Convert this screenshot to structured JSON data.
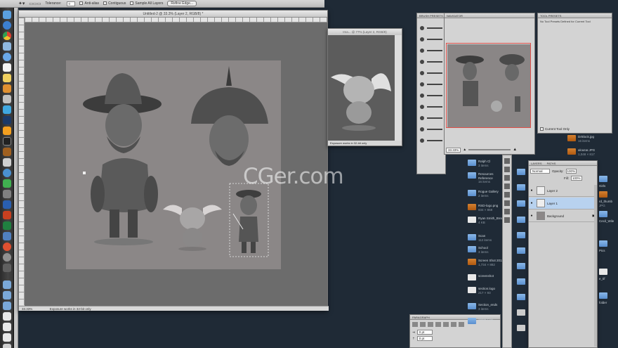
{
  "options_bar": {
    "tolerance_label": "Tolerance:",
    "tolerance_value": "0",
    "antialias_label": "Anti-alias",
    "contiguous_label": "Contiguous",
    "sample_label": "Sample All Layers",
    "refine_label": "Refine Edge..."
  },
  "document": {
    "title": "Untitled-2 @ 33.3% (Layer 2, RGB/8) *",
    "zoom": "33.33%",
    "status": "Exposure works in 32-bit only"
  },
  "document2": {
    "title": "Ima... @ 77% (Layer 2, RGB/8)",
    "status": "Exposure works in 32-bit only"
  },
  "panels": {
    "brush_presets_tab": "BRUSH PRESETS",
    "navigator_tab": "NAVIGATOR",
    "navigator_zoom": "33.33%",
    "tool_presets_tab": "TOOL PRESETS",
    "tool_presets_item": "No Tool Presets Defined for Current Tool",
    "current_tool_only": "Current Tool Only",
    "layers_tab": "LAYERS",
    "paths_tab": "PATHS",
    "blend_mode": "Normal",
    "opacity_label": "Opacity:",
    "opacity_value": "100%",
    "fill_label": "Fill:",
    "fill_value": "100%",
    "layers": [
      {
        "name": "Layer 2",
        "selected": false
      },
      {
        "name": "Layer 1",
        "selected": true
      },
      {
        "name": "Background",
        "selected": false
      }
    ],
    "paragraph_tab": "PARAGRAPH",
    "para_field_1": "0 pt",
    "para_field_2": "0 pt"
  },
  "finder_files": [
    {
      "name": "Ralph Cl",
      "sub": "3 items",
      "kind": "folder"
    },
    {
      "name": "Resources",
      "sub": "",
      "kind": "folder"
    },
    {
      "name": "Reference",
      "sub": "16 items",
      "kind": "folder"
    },
    {
      "name": "Rogue Gallery",
      "sub": "2 items",
      "kind": "folder"
    },
    {
      "name": "RSD-logo.png",
      "sub": "934 × 858",
      "kind": "image"
    },
    {
      "name": "Ryan Smith_Bread",
      "sub": "4 KB",
      "kind": "doc"
    },
    {
      "name": "Scan",
      "sub": "112 items",
      "kind": "folder"
    },
    {
      "name": "School",
      "sub": "3 items",
      "kind": "folder"
    },
    {
      "name": "Screen Shot 2012-03-...",
      "sub": "1,734 × 882",
      "kind": "image"
    },
    {
      "name": "screenshot",
      "sub": "",
      "kind": "doc"
    },
    {
      "name": "section.logo",
      "sub": "217 × 93",
      "kind": "doc"
    },
    {
      "name": "Section_ends",
      "sub": "3 items",
      "kind": "folder"
    },
    {
      "name": "Sister Cou...",
      "sub": "",
      "kind": "folder"
    }
  ],
  "finder_right": [
    {
      "name": "DrBlock.jpg",
      "sub": "16 items"
    },
    {
      "name": "alcazar.JPG",
      "sub": "1,048 × 817"
    },
    {
      "name": "Girls",
      "sub": ""
    },
    {
      "name": "rd_thumb",
      "sub": "JPG"
    },
    {
      "name": "Cecil_Wile",
      "sub": ""
    },
    {
      "name": "Pics",
      "sub": ""
    },
    {
      "name": "e_tif",
      "sub": ""
    },
    {
      "name": "folder",
      "sub": ""
    }
  ],
  "watermark": "CGer.com",
  "colors": {
    "desktop": "#1f2a36",
    "canvas": "#8b8787",
    "pasteboard": "#6c6c6c",
    "navigator_box": "#e0504a",
    "layer_selected": "#b8d2ef"
  }
}
